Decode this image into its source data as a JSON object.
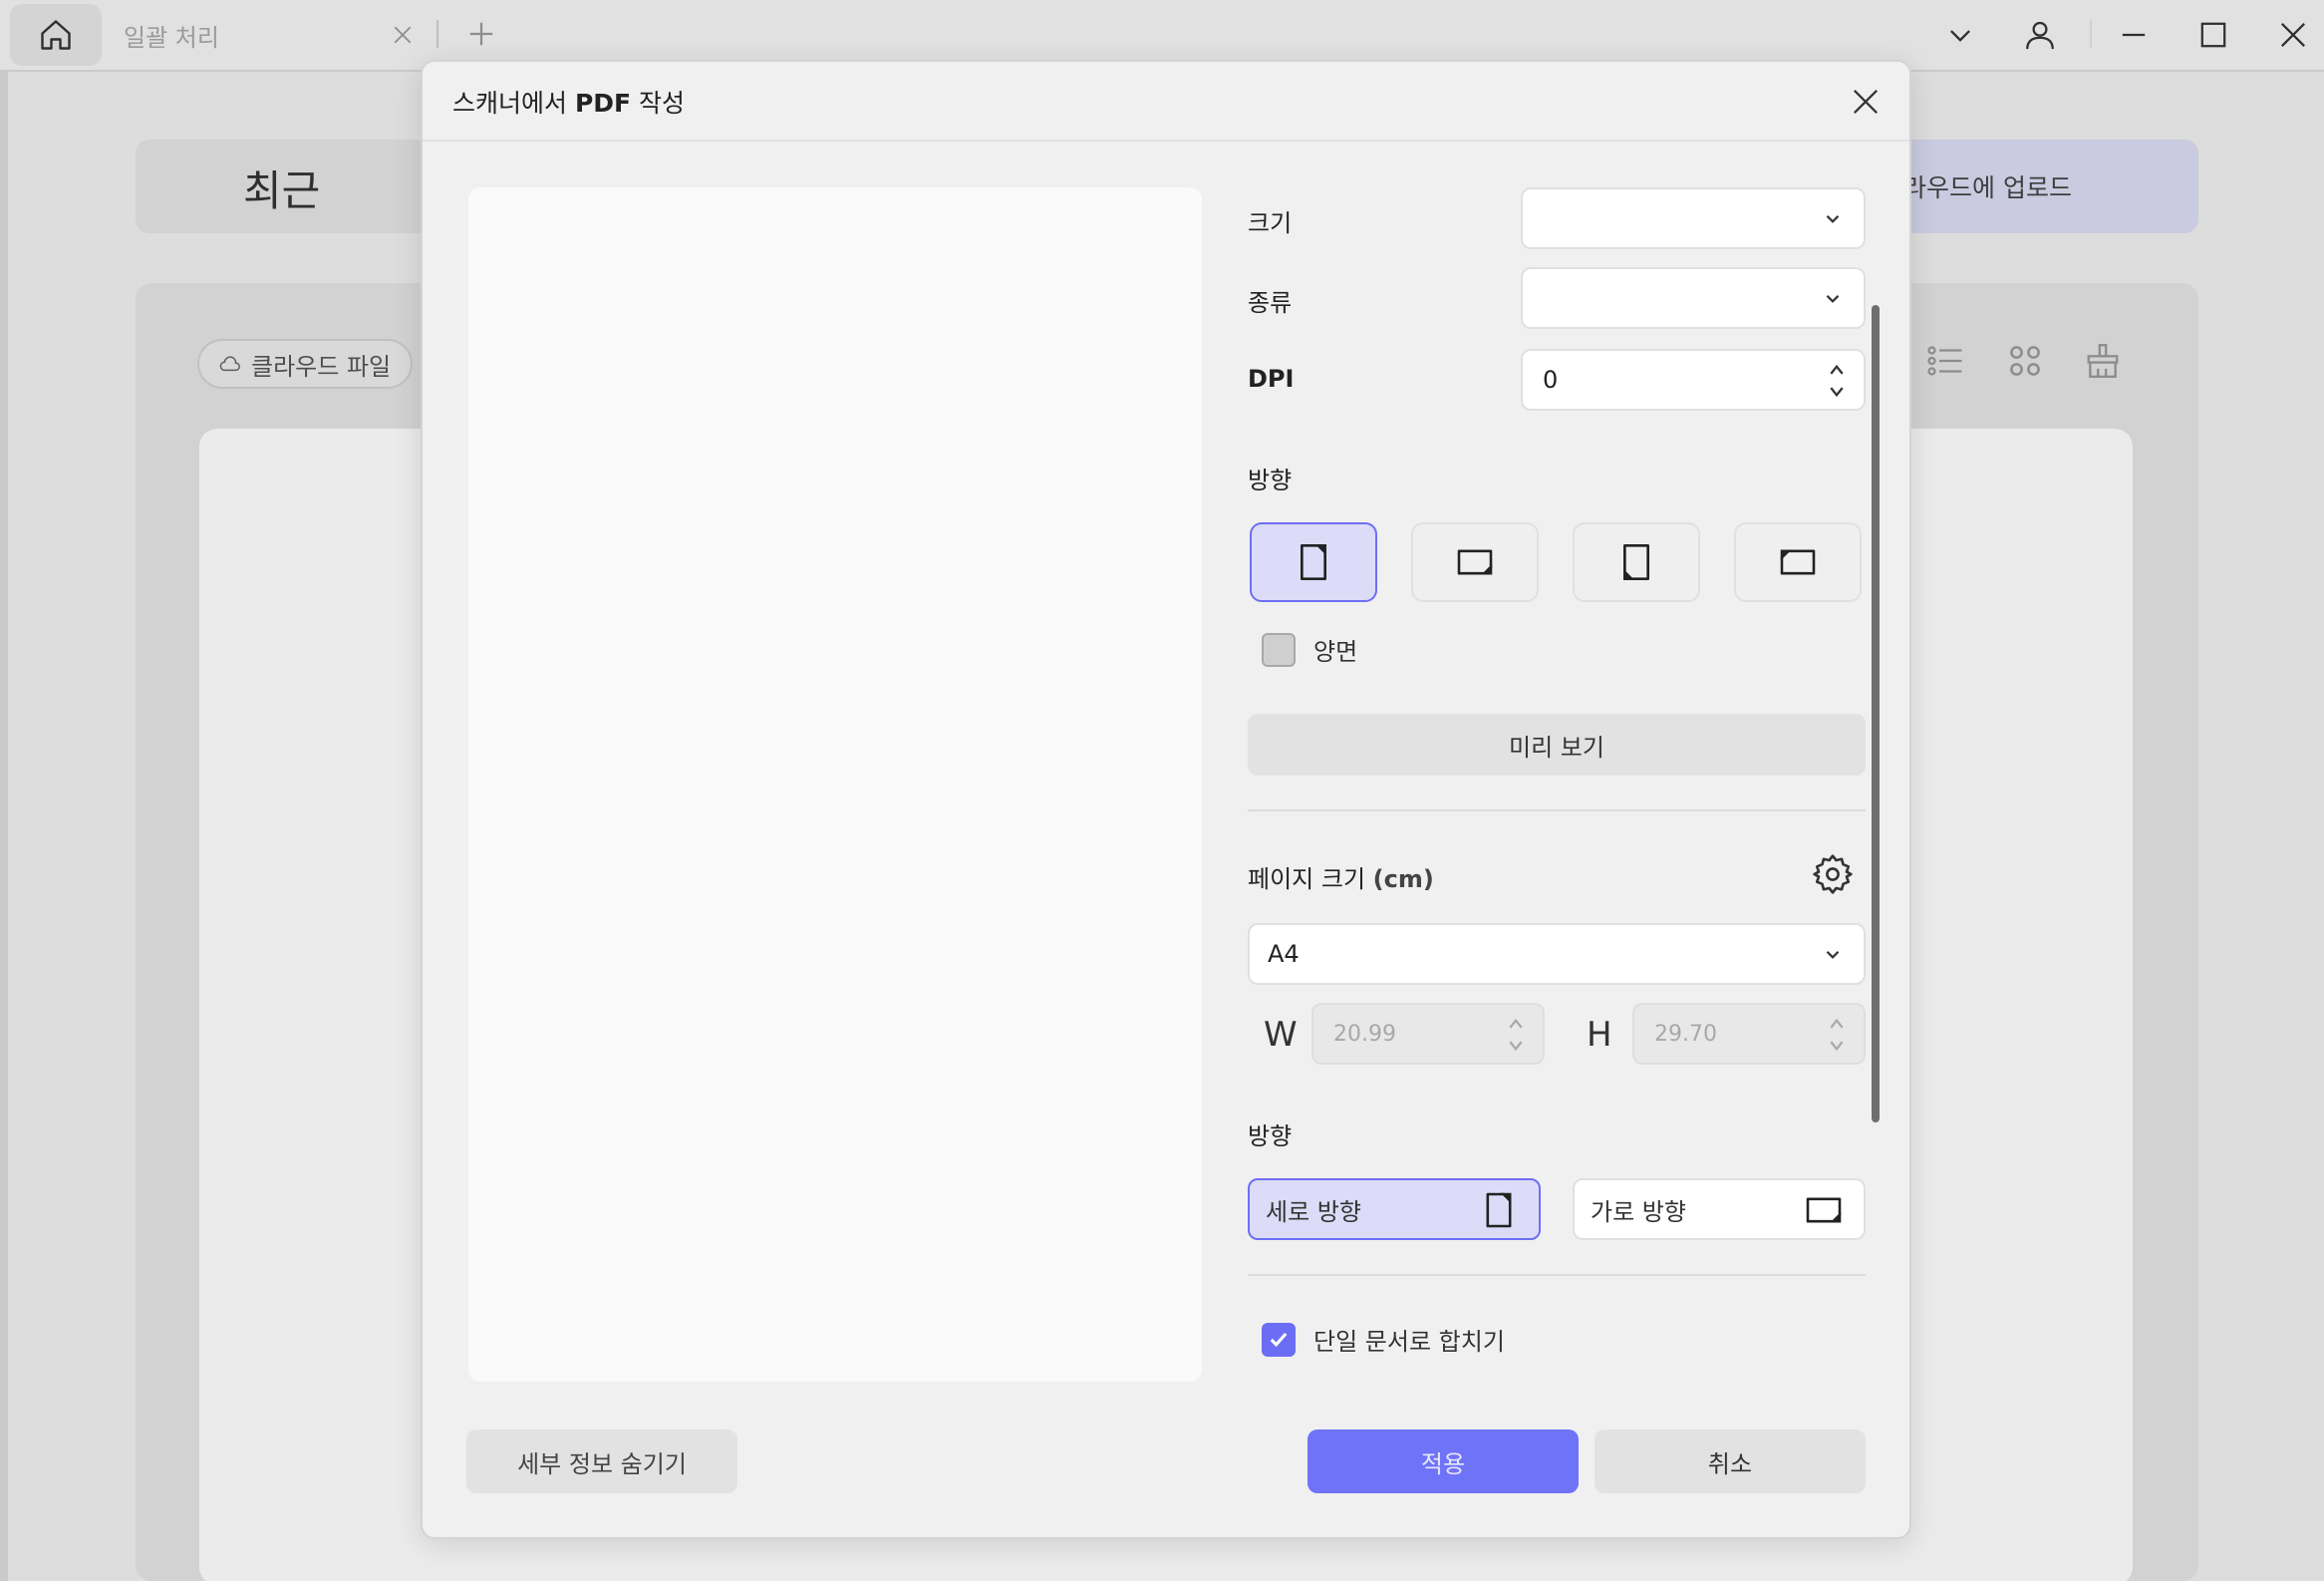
{
  "titlebar": {
    "tab_label": "일괄 처리"
  },
  "background": {
    "recent_title": "최근",
    "upload_label": "라우드에 업로드",
    "cloud_files_label": "클라우드 파일"
  },
  "dialog": {
    "title_prefix": "스캐너에서 ",
    "title_bold": "PDF",
    "title_suffix": " 작성",
    "size_label": "크기",
    "size_value": "",
    "type_label": "종류",
    "type_value": "",
    "dpi_label": "DPI",
    "dpi_value": "0",
    "orientation_label": "방향",
    "duplex_label": "양면",
    "duplex_checked": false,
    "preview_button": "미리 보기",
    "page_size_label": "페이지 크기 ",
    "page_size_unit": "(cm)",
    "paper_value": "A4",
    "width_letter": "W",
    "width_value": "20.99",
    "height_letter": "H",
    "height_value": "29.70",
    "page_orientation_label": "방향",
    "portrait_label": "세로 방향",
    "landscape_label": "가로 방향",
    "merge_label": "단일 문서로 합치기",
    "merge_checked": true,
    "hide_details_button": "세부 정보 숨기기",
    "apply_button": "적용",
    "cancel_button": "취소"
  },
  "colors": {
    "accent": "#6f73f7",
    "accent_light": "#dcdcf8"
  }
}
